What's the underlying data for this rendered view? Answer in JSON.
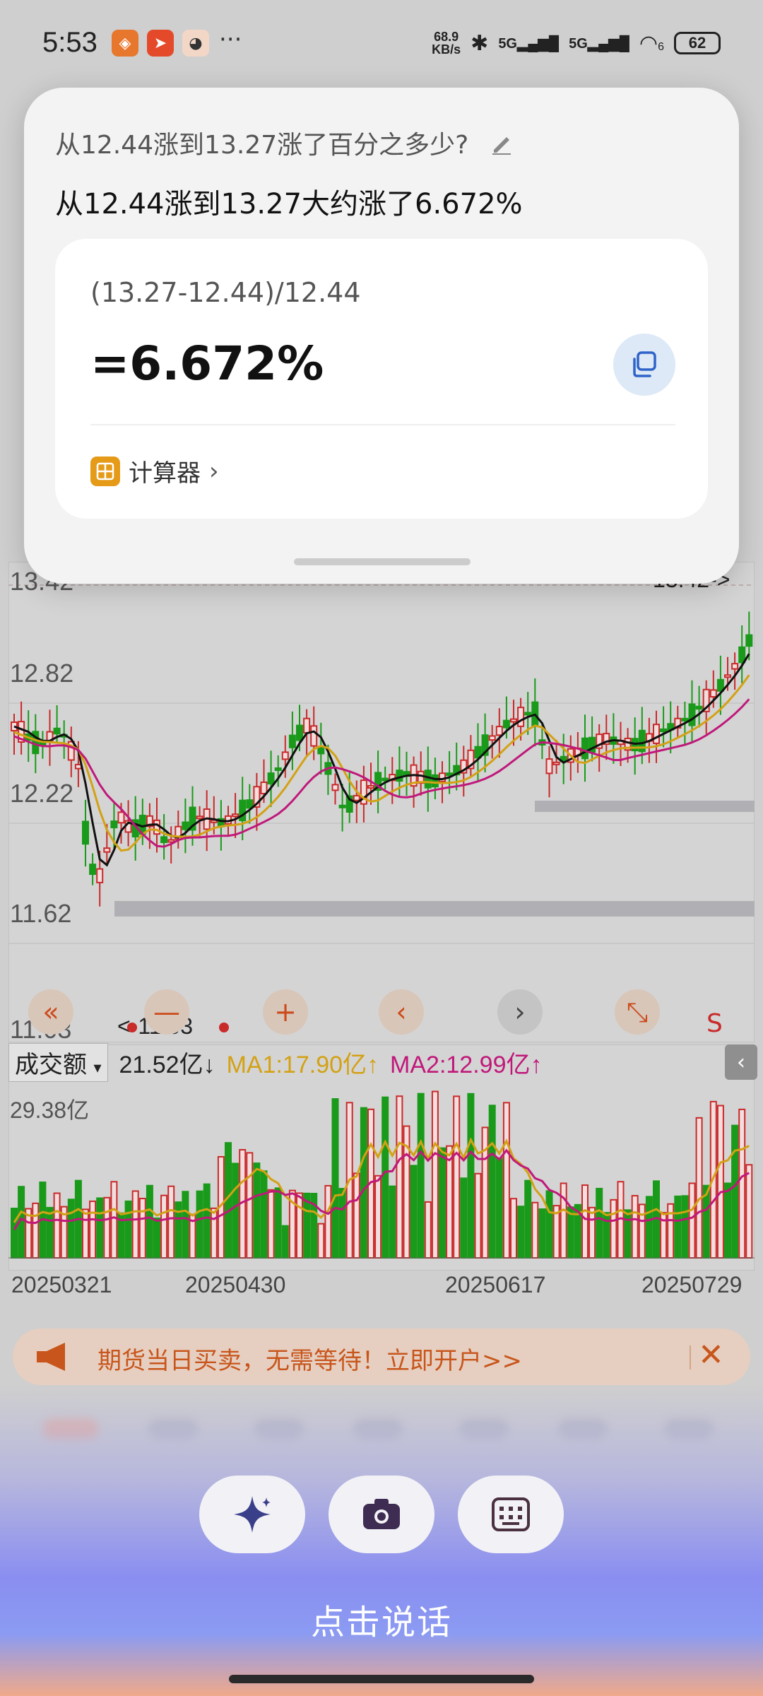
{
  "status_bar": {
    "time": "5:53",
    "net_speed_value": "68.9",
    "net_speed_unit": "KB/s",
    "signal1": "5G",
    "signal2": "5G",
    "wifi_num": "6",
    "battery": "62",
    "more": "···"
  },
  "popup": {
    "question": "从12.44涨到13.27涨了百分之多少?",
    "answer": "从12.44涨到13.27大约涨了6.672%",
    "formula": "(13.27-12.44)/12.44",
    "result": "=6.672%",
    "calculator_label": "计算器",
    "calculator_chevron": "›"
  },
  "chart": {
    "y_labels": [
      "13.42",
      "12.82",
      "12.22",
      "11.62",
      "11.03"
    ],
    "low_marker": "<-11.03",
    "high_marker": "13.42->",
    "s_label": "S",
    "controls": [
      "«",
      "—",
      "+",
      "‹",
      "›",
      "⤡"
    ]
  },
  "volume": {
    "selector": "成交额",
    "selector_arrow": "▾",
    "value": "21.52亿↓",
    "ma1": "MA1:17.90亿↑",
    "ma2": "MA2:12.99亿↑",
    "max_label": "29.38亿",
    "back": "‹"
  },
  "dates": [
    "20250321",
    "20250430",
    "20250617",
    "20250729"
  ],
  "ad": {
    "text": "期货当日买卖，无需等待！立即开户>>",
    "close": "✕"
  },
  "assistant": {
    "speak_label": "点击说话"
  },
  "colors": {
    "up": "#c92a2a",
    "down": "#1a9a1a",
    "ma1": "#d3a114",
    "ma2": "#c0187a",
    "accent": "#c8551b"
  }
}
